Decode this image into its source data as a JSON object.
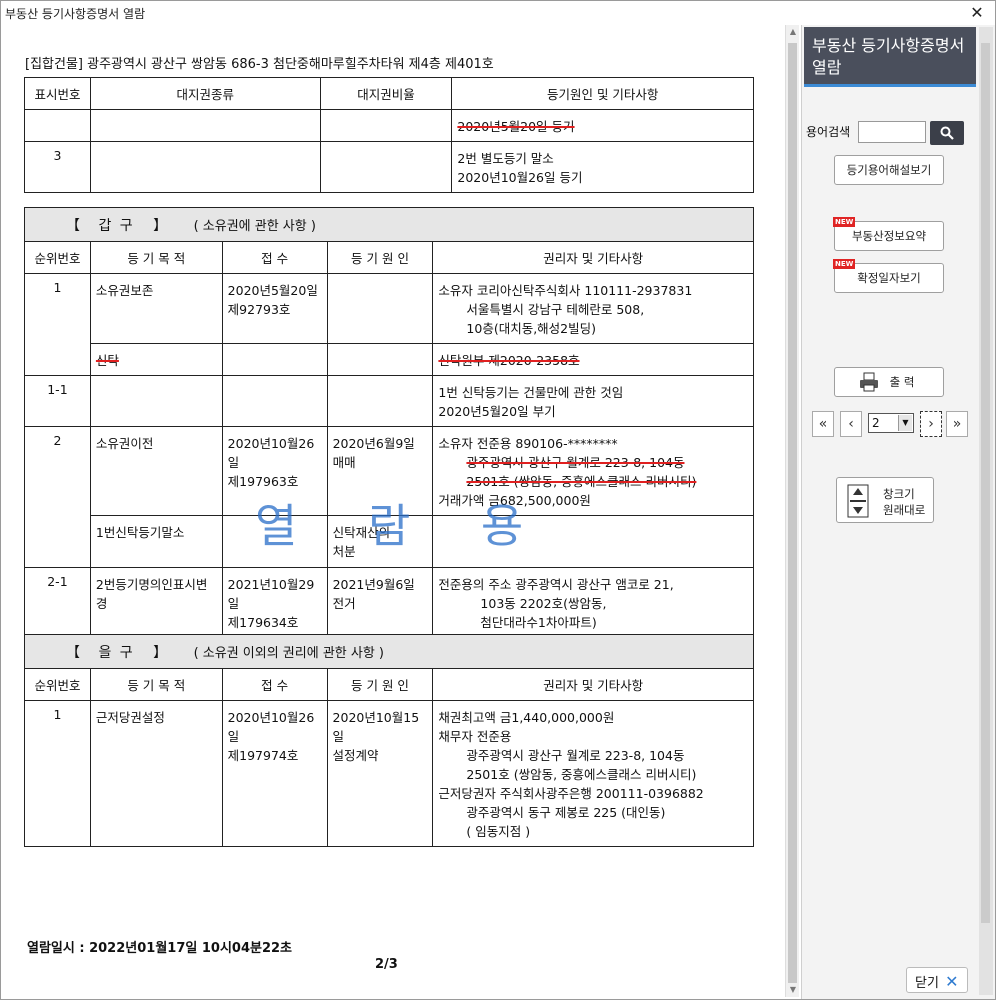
{
  "window": {
    "title": "부동산 등기사항증명서 열람",
    "close_glyph": "✕"
  },
  "document": {
    "address": "[집합건물]  광주광역시 광산구 쌍암동 686-3 첨단중해마루힐주차타워 제4층 제401호",
    "land_table": {
      "headers": [
        "표시번호",
        "대지권종류",
        "대지권비율",
        "등기원인 및 기타사항"
      ],
      "rows": [
        {
          "no": "",
          "kind": "",
          "ratio": "",
          "cause": "2020년5월20일 등기",
          "struck": true
        },
        {
          "no": "3",
          "kind": "",
          "ratio": "",
          "cause_lines": [
            "2번 별도등기 말소",
            "2020년10월26일 등기"
          ]
        }
      ]
    },
    "gap": {
      "title_bracket_open": "【",
      "title_name": "갑        구",
      "title_bracket_close": "】",
      "title_sub": "( 소유권에 관한 사항 )",
      "headers": [
        "순위번호",
        "등 기 목 적",
        "접    수",
        "등 기 원 인",
        "권리자 및 기타사항"
      ],
      "rows": [
        {
          "no": "1",
          "purpose": "소유권보존",
          "receipt": [
            "2020년5월20일",
            "제92793호"
          ],
          "cause": [],
          "rights": [
            "소유자   코리아신탁주식회사   110111-2937831",
            "서울특별시 강남구 테헤란로 508,",
            "10층(대치동,해성2빌딩)"
          ]
        },
        {
          "no": "",
          "purpose": "신탁",
          "receipt": [],
          "cause": [],
          "rights": [
            "신탁원부   제2020-2358호"
          ],
          "struck": true
        },
        {
          "no": "1-1",
          "purpose": "",
          "receipt": [],
          "cause": [],
          "rights": [
            "1번 신탁등기는 건물만에 관한 것임",
            "2020년5월20일    부기"
          ]
        },
        {
          "no": "2",
          "purpose": "소유권이전",
          "receipt": [
            "2020년10월26일",
            "제197963호"
          ],
          "cause": [
            "2020년6월9일",
            "매매"
          ],
          "rights": [
            "소유자   전준용   890106-********",
            "광주광역시 광산구 월계로 223-8, 104동",
            "2501호 (쌍암동, 중흥에스클래스 리버시티)",
            "거래가액 금682,500,000원"
          ]
        },
        {
          "no": "",
          "purpose": "1번신탁등기말소",
          "receipt": [],
          "cause": [
            "신탁재산의",
            "처분"
          ],
          "rights": []
        },
        {
          "no": "2-1",
          "purpose": "2번등기명의인표시변경",
          "receipt": [
            "2021년10월29일",
            "제179634호"
          ],
          "cause": [
            "2021년9월6일",
            "전거"
          ],
          "rights": [
            "전준용의 주소   광주광역시 광산구 앰코로 21,",
            "103동 2202호(쌍암동,",
            "첨단대라수1차아파트)"
          ]
        }
      ]
    },
    "eul": {
      "title_bracket_open": "【",
      "title_name": "을        구",
      "title_bracket_close": "】",
      "title_sub": "( 소유권 이외의 권리에 관한 사항 )",
      "headers": [
        "순위번호",
        "등 기 목 적",
        "접    수",
        "등 기 원 인",
        "권리자 및 기타사항"
      ],
      "rows": [
        {
          "no": "1",
          "purpose": "근저당권설정",
          "receipt": [
            "2020년10월26일",
            "제197974호"
          ],
          "cause": [
            "2020년10월15일",
            "설정계약"
          ],
          "rights": [
            "채권최고액   금1,440,000,000원",
            "채무자   전준용",
            "광주광역시 광산구 월계로 223-8, 104동",
            "2501호 (쌍암동, 중흥에스클래스 리버시티)",
            "근저당권자   주식회사광주은행   200111-0396882",
            "광주광역시 동구 제봉로 225 (대인동)",
            "( 임동지점 )"
          ]
        }
      ]
    },
    "watermark": "열 람 용",
    "issue_datetime": "열람일시  :  2022년01월17일  10시04분22초",
    "page_indicator": "2/3"
  },
  "sidebar": {
    "title": "부동산 등기사항증명서 열람",
    "search_label": "용어검색",
    "search_value": "",
    "glossary_button": "등기용어해설보기",
    "new_badge": "NEW",
    "summary_button": "부동산정보요약",
    "date_button": "확정일자보기",
    "print_button": "출 력",
    "page_select": "2",
    "resize_button_lines": [
      "창크기",
      "원래대로"
    ],
    "close_button": "닫기"
  }
}
